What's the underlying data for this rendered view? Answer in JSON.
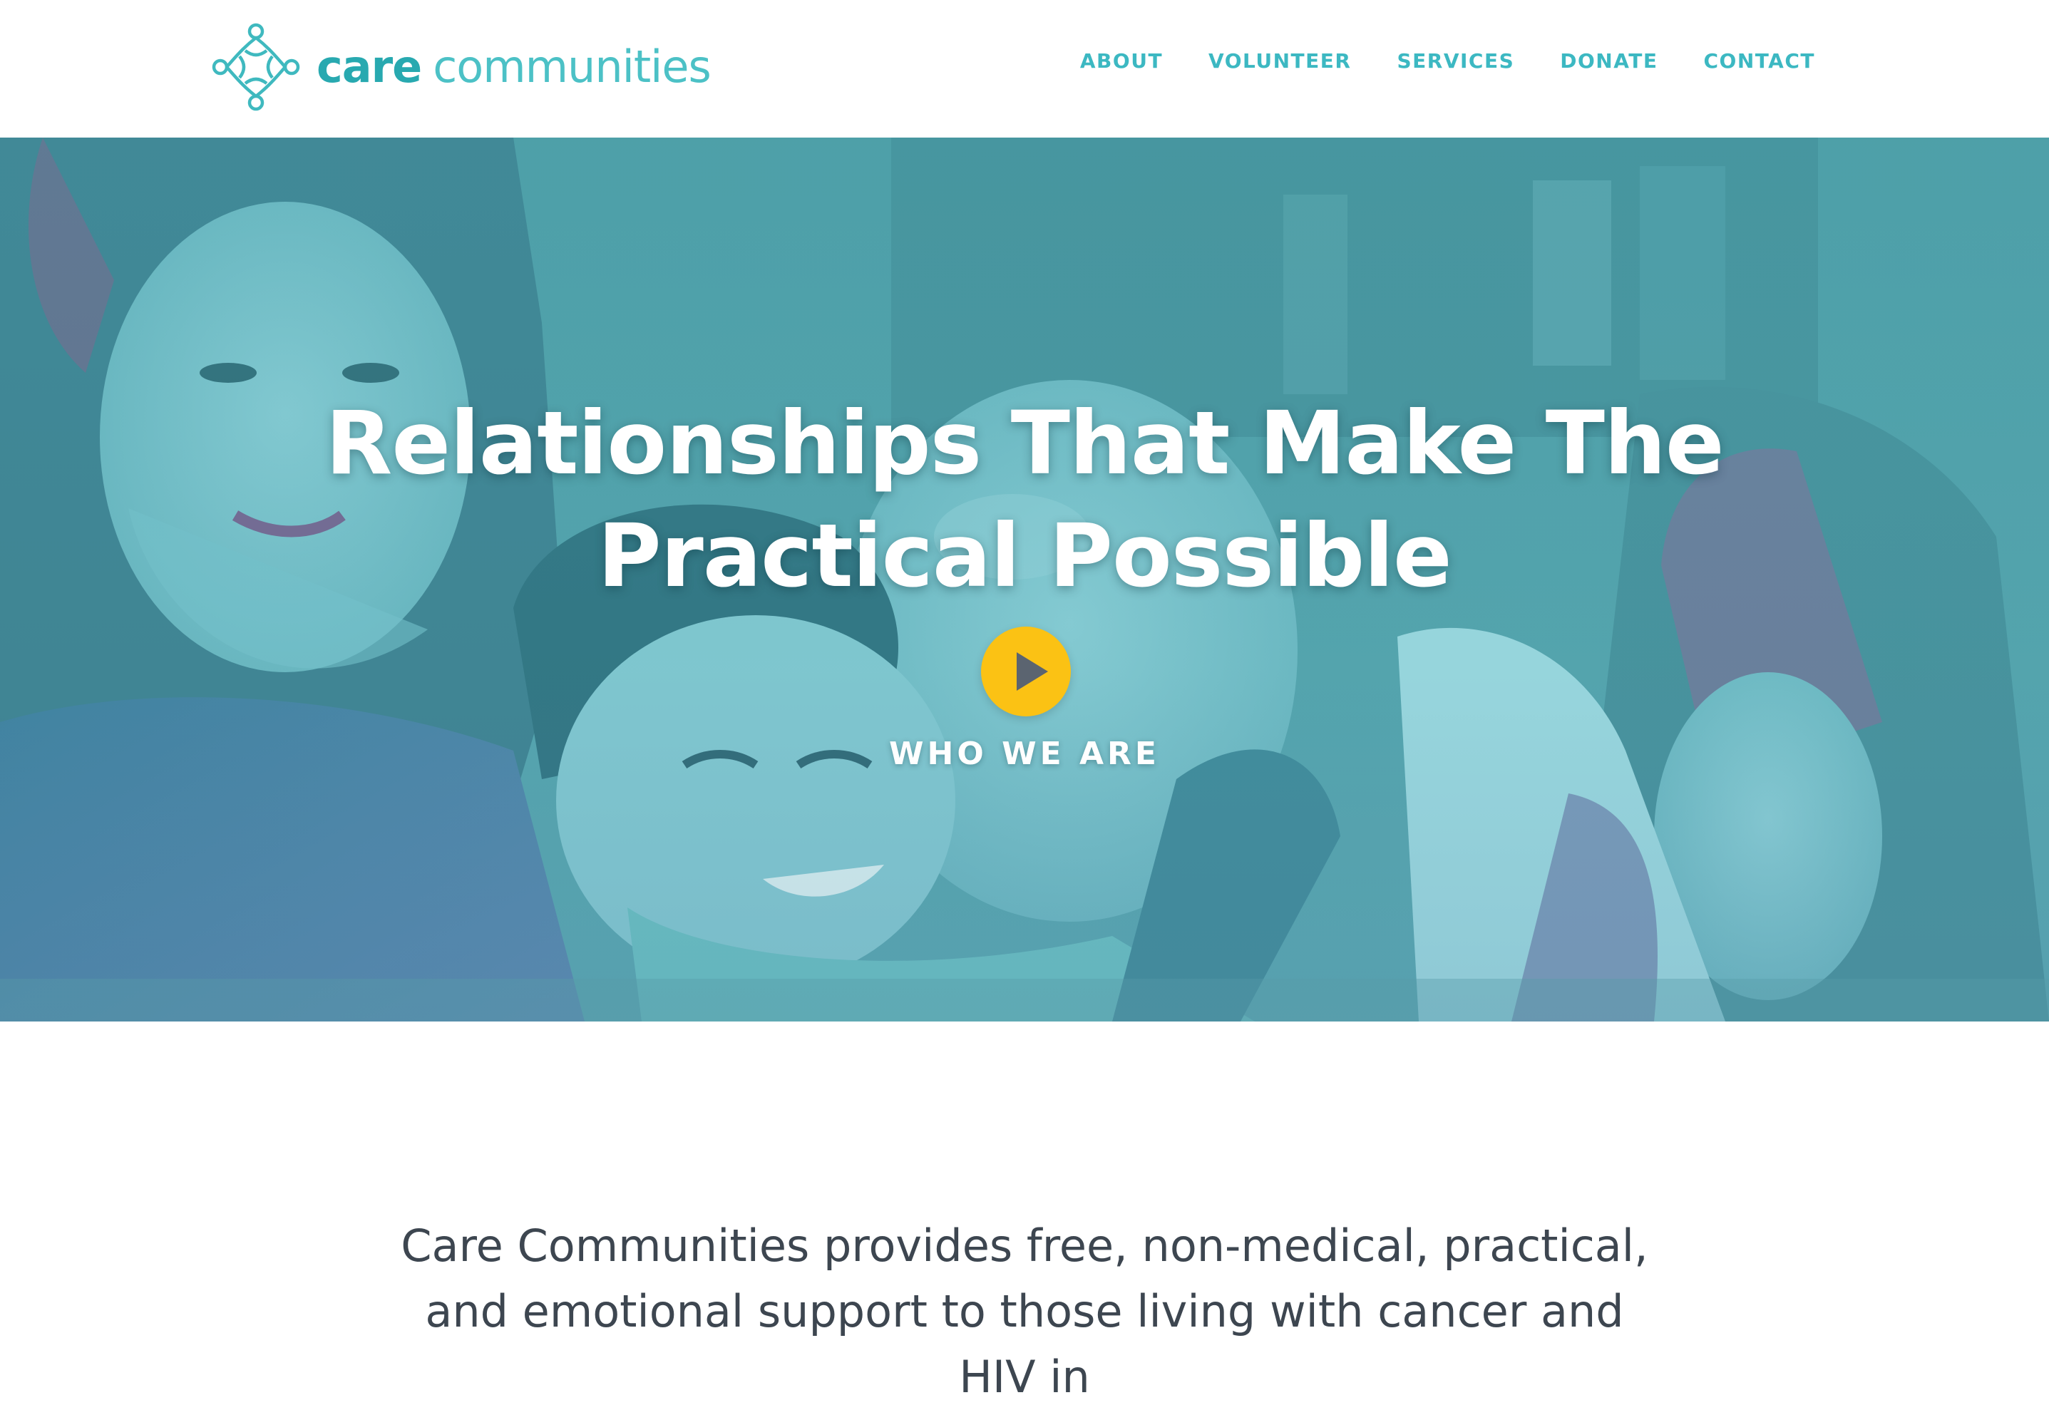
{
  "header": {
    "logo": {
      "word_care": "care",
      "word_communities": "communities"
    },
    "nav": [
      {
        "label": "ABOUT"
      },
      {
        "label": "VOLUNTEER"
      },
      {
        "label": "SERVICES"
      },
      {
        "label": "DONATE"
      },
      {
        "label": "CONTACT"
      }
    ]
  },
  "hero": {
    "title_line1": "Relationships That Make The",
    "title_line2": "Practical Possible",
    "play_icon": "play-icon",
    "link_label": "WHO WE ARE"
  },
  "intro": {
    "text": "Care Communities provides free, non-medical, practical, and emotional support to those living with cancer and HIV in"
  },
  "colors": {
    "brand_teal": "#28a9b0",
    "brand_teal_light": "#4cc1c6",
    "nav_text": "#3cb8c2",
    "play_button": "#fbc214",
    "body_text": "#3d4650"
  }
}
